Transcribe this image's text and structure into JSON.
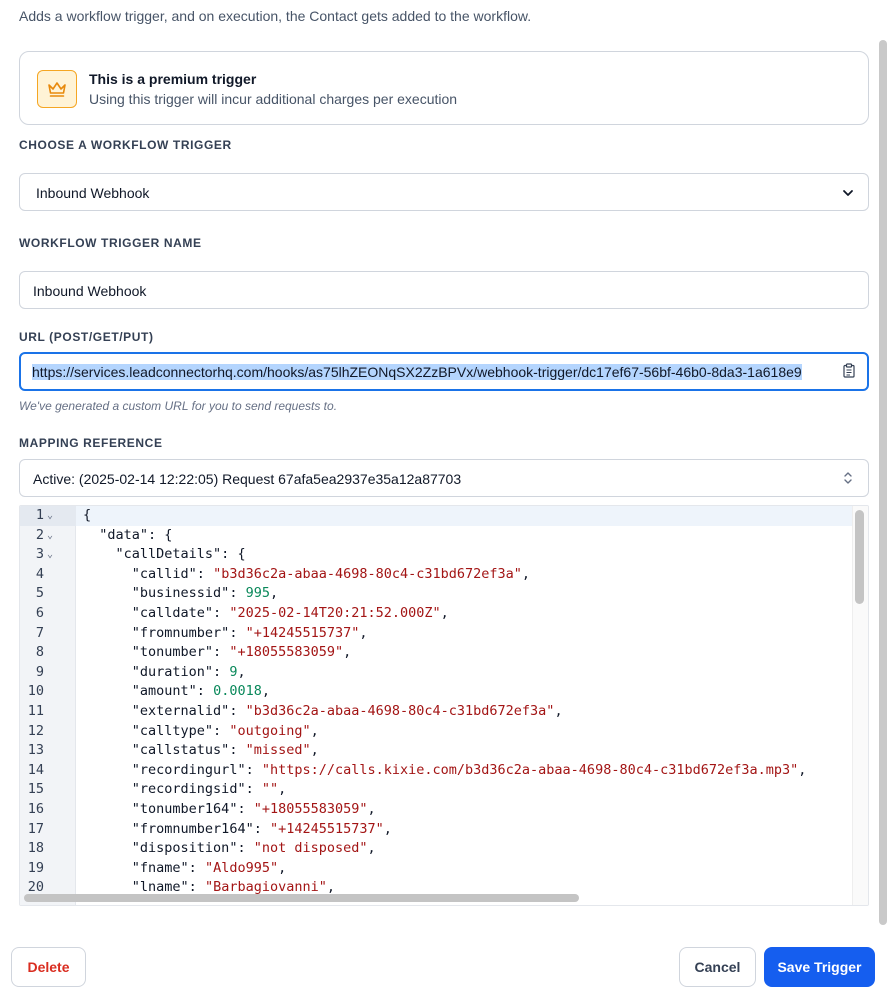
{
  "description": "Adds a workflow trigger, and on execution, the Contact gets added to the workflow.",
  "premium": {
    "title": "This is a premium trigger",
    "subtitle": "Using this trigger will incur additional charges per execution",
    "icon": "crown-icon"
  },
  "trigger_select": {
    "label": "CHOOSE A WORKFLOW TRIGGER",
    "value": "Inbound Webhook"
  },
  "trigger_name": {
    "label": "WORKFLOW TRIGGER NAME",
    "value": "Inbound Webhook"
  },
  "url": {
    "label": "URL (POST/GET/PUT)",
    "value": "https://services.leadconnectorhq.com/hooks/as75lhZEONqSX2ZzBPVx/webhook-trigger/dc17ef67-56bf-46b0-8da3-1a618e9",
    "hint": "We've generated a custom URL for you to send requests to."
  },
  "mapping": {
    "label": "MAPPING REFERENCE",
    "value": "Active: (2025-02-14 12:22:05) Request 67afa5ea2937e35a12a87703"
  },
  "code_lines": [
    {
      "n": "1",
      "fold": true,
      "indent": "",
      "key": "",
      "value": "{",
      "type": "punct",
      "suffix": ""
    },
    {
      "n": "2",
      "fold": true,
      "indent": "  ",
      "key": "\"data\": ",
      "value": "{",
      "type": "punct",
      "suffix": ""
    },
    {
      "n": "3",
      "fold": true,
      "indent": "    ",
      "key": "\"callDetails\": ",
      "value": "{",
      "type": "punct",
      "suffix": ""
    },
    {
      "n": "4",
      "fold": false,
      "indent": "      ",
      "key": "\"callid\": ",
      "value": "\"b3d36c2a-abaa-4698-80c4-c31bd672ef3a\"",
      "type": "str",
      "suffix": ","
    },
    {
      "n": "5",
      "fold": false,
      "indent": "      ",
      "key": "\"businessid\": ",
      "value": "995",
      "type": "num",
      "suffix": ","
    },
    {
      "n": "6",
      "fold": false,
      "indent": "      ",
      "key": "\"calldate\": ",
      "value": "\"2025-02-14T20:21:52.000Z\"",
      "type": "str",
      "suffix": ","
    },
    {
      "n": "7",
      "fold": false,
      "indent": "      ",
      "key": "\"fromnumber\": ",
      "value": "\"+14245515737\"",
      "type": "str",
      "suffix": ","
    },
    {
      "n": "8",
      "fold": false,
      "indent": "      ",
      "key": "\"tonumber\": ",
      "value": "\"+18055583059\"",
      "type": "str",
      "suffix": ","
    },
    {
      "n": "9",
      "fold": false,
      "indent": "      ",
      "key": "\"duration\": ",
      "value": "9",
      "type": "num",
      "suffix": ","
    },
    {
      "n": "10",
      "fold": false,
      "indent": "      ",
      "key": "\"amount\": ",
      "value": "0.0018",
      "type": "num",
      "suffix": ","
    },
    {
      "n": "11",
      "fold": false,
      "indent": "      ",
      "key": "\"externalid\": ",
      "value": "\"b3d36c2a-abaa-4698-80c4-c31bd672ef3a\"",
      "type": "str",
      "suffix": ","
    },
    {
      "n": "12",
      "fold": false,
      "indent": "      ",
      "key": "\"calltype\": ",
      "value": "\"outgoing\"",
      "type": "str",
      "suffix": ","
    },
    {
      "n": "13",
      "fold": false,
      "indent": "      ",
      "key": "\"callstatus\": ",
      "value": "\"missed\"",
      "type": "str",
      "suffix": ","
    },
    {
      "n": "14",
      "fold": false,
      "indent": "      ",
      "key": "\"recordingurl\": ",
      "value": "\"https://calls.kixie.com/b3d36c2a-abaa-4698-80c4-c31bd672ef3a.mp3\"",
      "type": "str",
      "suffix": ","
    },
    {
      "n": "15",
      "fold": false,
      "indent": "      ",
      "key": "\"recordingsid\": ",
      "value": "\"\"",
      "type": "str",
      "suffix": ","
    },
    {
      "n": "16",
      "fold": false,
      "indent": "      ",
      "key": "\"tonumber164\": ",
      "value": "\"+18055583059\"",
      "type": "str",
      "suffix": ","
    },
    {
      "n": "17",
      "fold": false,
      "indent": "      ",
      "key": "\"fromnumber164\": ",
      "value": "\"+14245515737\"",
      "type": "str",
      "suffix": ","
    },
    {
      "n": "18",
      "fold": false,
      "indent": "      ",
      "key": "\"disposition\": ",
      "value": "\"not disposed\"",
      "type": "str",
      "suffix": ","
    },
    {
      "n": "19",
      "fold": false,
      "indent": "      ",
      "key": "\"fname\": ",
      "value": "\"Aldo995\"",
      "type": "str",
      "suffix": ","
    },
    {
      "n": "20",
      "fold": false,
      "indent": "      ",
      "key": "\"lname\": ",
      "value": "\"Barbagiovanni\"",
      "type": "str",
      "suffix": ","
    }
  ],
  "buttons": {
    "delete": "Delete",
    "cancel": "Cancel",
    "save": "Save Trigger"
  },
  "colors": {
    "primary": "#155eef",
    "danger": "#d92d20",
    "premium_bg": "#fff3d6",
    "premium_border": "#f5a623",
    "code_string": "#a31515",
    "code_number": "#09885a"
  }
}
